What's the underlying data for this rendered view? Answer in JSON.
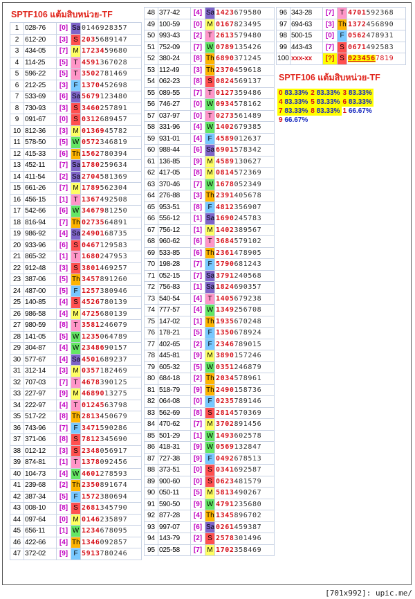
{
  "title": "SPTF106 แต้มสิบหน่วย-TF",
  "footer": "[701x992]: upic.me/",
  "colors": {
    "Sa": "#7e64c8",
    "T": "#ff96c8",
    "M": "#ffff64",
    "W": "#64e664",
    "F": "#78c8ff",
    "S": "#ff5050",
    "Th": "#ffb400"
  },
  "rows": [
    [
      "1",
      "028-76",
      "0",
      "Sa",
      "0146928357",
      "0"
    ],
    [
      "2",
      "612-20",
      "3",
      "S",
      "2035689147",
      "3"
    ],
    [
      "3",
      "434-05",
      "7",
      "M",
      "1723459680",
      "5"
    ],
    [
      "4",
      "114-25",
      "5",
      "T",
      "4591367028",
      "4"
    ],
    [
      "5",
      "596-22",
      "5",
      "T",
      "3502781469",
      "4"
    ],
    [
      "6",
      "212-25",
      "3",
      "F",
      "1370452698",
      "4"
    ],
    [
      "7",
      "533-69",
      "6",
      "Sa",
      "5679123480",
      "4"
    ],
    [
      "8",
      "730-93",
      "3",
      "S",
      "3460257891",
      "4"
    ],
    [
      "9",
      "091-67",
      "0",
      "S",
      "0312689457",
      "4"
    ],
    [
      "10",
      "812-36",
      "3",
      "M",
      "0136945782",
      "5"
    ],
    [
      "11",
      "578-50",
      "5",
      "W",
      "0572346819",
      "4"
    ],
    [
      "12",
      "415-33",
      "6",
      "Th",
      "1562780394",
      "4"
    ],
    [
      "13",
      "452-11",
      "7",
      "Sa",
      "1780259634",
      "4"
    ],
    [
      "14",
      "411-54",
      "2",
      "Sa",
      "2704581369",
      "4"
    ],
    [
      "15",
      "661-26",
      "7",
      "M",
      "1789562304",
      "4"
    ],
    [
      "16",
      "456-15",
      "1",
      "T",
      "1367492508",
      "4"
    ],
    [
      "17",
      "542-66",
      "6",
      "W",
      "3467981250",
      "5"
    ],
    [
      "18",
      "816-94",
      "7",
      "Th",
      "0273564891",
      "5"
    ],
    [
      "19",
      "986-92",
      "4",
      "Sa",
      "2490168735",
      "5"
    ],
    [
      "20",
      "933-96",
      "6",
      "S",
      "0467129583",
      "4"
    ],
    [
      "21",
      "865-32",
      "1",
      "T",
      "1680247953",
      "4"
    ],
    [
      "22",
      "912-48",
      "3",
      "S",
      "3801469257",
      "4"
    ],
    [
      "23",
      "387-06",
      "5",
      "Th",
      "3457891260",
      "4"
    ],
    [
      "24",
      "487-00",
      "5",
      "F",
      "1257380946",
      "4"
    ],
    [
      "25",
      "140-85",
      "4",
      "S",
      "4526780139",
      "4"
    ],
    [
      "26",
      "986-58",
      "4",
      "M",
      "4725680139",
      "4"
    ],
    [
      "27",
      "980-59",
      "8",
      "T",
      "3581246079",
      "4"
    ],
    [
      "28",
      "141-05",
      "5",
      "W",
      "1235064789",
      "4"
    ],
    [
      "29",
      "304-87",
      "4",
      "W",
      "2348690157",
      "5"
    ],
    [
      "30",
      "577-67",
      "4",
      "Sa",
      "4501689237",
      "4"
    ],
    [
      "31",
      "312-14",
      "3",
      "M",
      "0357182469",
      "4"
    ],
    [
      "32",
      "707-03",
      "7",
      "T",
      "4678390125",
      "4"
    ],
    [
      "33",
      "227-97",
      "9",
      "M",
      "4689013275",
      "5"
    ],
    [
      "34",
      "222-97",
      "4",
      "T",
      "0124563798",
      "5"
    ],
    [
      "35",
      "517-22",
      "8",
      "Th",
      "2813450679",
      "4"
    ],
    [
      "36",
      "743-96",
      "7",
      "F",
      "3471590286",
      "4"
    ],
    [
      "37",
      "371-06",
      "8",
      "S",
      "7812345690",
      "4"
    ],
    [
      "38",
      "012-12",
      "3",
      "S",
      "2348056917",
      "4"
    ],
    [
      "39",
      "874-81",
      "1",
      "T",
      "1378092456",
      "4"
    ],
    [
      "40",
      "104-73",
      "4",
      "W",
      "4601278593",
      "4"
    ],
    [
      "41",
      "239-68",
      "2",
      "Th",
      "2350891674",
      "4"
    ],
    [
      "42",
      "387-34",
      "5",
      "F",
      "1572380694",
      "4"
    ],
    [
      "43",
      "008-10",
      "8",
      "S",
      "2681345790",
      "4"
    ],
    [
      "44",
      "097-64",
      "0",
      "M",
      "0146235897",
      "4"
    ],
    [
      "45",
      "656-11",
      "1",
      "W",
      "1234678095",
      "4"
    ],
    [
      "46",
      "422-66",
      "4",
      "Th",
      "1346092857",
      "4"
    ],
    [
      "47",
      "372-02",
      "9",
      "F",
      "5913780246",
      "4"
    ],
    [
      "48",
      "377-42",
      "4",
      "Sa",
      "1423679580",
      "4"
    ],
    [
      "49",
      "100-59",
      "0",
      "M",
      "0167823495",
      "4"
    ],
    [
      "50",
      "993-43",
      "2",
      "T",
      "2613579480",
      "4"
    ],
    [
      "51",
      "752-09",
      "7",
      "W",
      "0789135426",
      "4"
    ],
    [
      "52",
      "380-24",
      "8",
      "Th",
      "6890371245",
      "4"
    ],
    [
      "53",
      "112-49",
      "3",
      "Th",
      "2370459618",
      "4"
    ],
    [
      "54",
      "062-23",
      "8",
      "S",
      "0824569137",
      "4"
    ],
    [
      "55",
      "089-55",
      "7",
      "T",
      "0127359486",
      "4"
    ],
    [
      "56",
      "746-27",
      "0",
      "W",
      "0934578162",
      "4"
    ],
    [
      "57",
      "037-97",
      "0",
      "T",
      "0273561489",
      "4"
    ],
    [
      "58",
      "331-96",
      "4",
      "W",
      "1402679385",
      "4"
    ],
    [
      "59",
      "931-01",
      "4",
      "F",
      "4589012637",
      "4"
    ],
    [
      "60",
      "988-44",
      "6",
      "Sa",
      "6901578342",
      "4"
    ],
    [
      "61",
      "136-85",
      "9",
      "M",
      "4589130627",
      "4"
    ],
    [
      "62",
      "417-05",
      "8",
      "M",
      "0814572369",
      "4"
    ],
    [
      "63",
      "370-46",
      "7",
      "W",
      "1678052349",
      "4"
    ],
    [
      "64",
      "276-88",
      "3",
      "Th",
      "2391405678",
      "4"
    ],
    [
      "65",
      "953-51",
      "8",
      "F",
      "4812356907",
      "4"
    ],
    [
      "66",
      "556-12",
      "1",
      "Sa",
      "1690245783",
      "4"
    ],
    [
      "67",
      "756-12",
      "1",
      "M",
      "1402389567",
      "4"
    ],
    [
      "68",
      "960-62",
      "6",
      "T",
      "3684579102",
      "4"
    ],
    [
      "69",
      "533-85",
      "6",
      "Th",
      "2361478905",
      "4"
    ],
    [
      "70",
      "198-28",
      "7",
      "F",
      "5790681243",
      "4"
    ],
    [
      "71",
      "052-15",
      "7",
      "Sa",
      "3791240568",
      "4"
    ],
    [
      "72",
      "756-83",
      "1",
      "Sa",
      "1824690357",
      "4"
    ],
    [
      "73",
      "540-54",
      "4",
      "T",
      "1405679238",
      "4"
    ],
    [
      "74",
      "777-57",
      "4",
      "W",
      "1349256708",
      "4"
    ],
    [
      "75",
      "147-02",
      "1",
      "Th",
      "1935670248",
      "4"
    ],
    [
      "76",
      "178-21",
      "5",
      "F",
      "1350678924",
      "4"
    ],
    [
      "77",
      "402-65",
      "2",
      "F",
      "2346789015",
      "4"
    ],
    [
      "78",
      "445-81",
      "9",
      "M",
      "3890157246",
      "4"
    ],
    [
      "79",
      "605-32",
      "5",
      "W",
      "0351246879",
      "4"
    ],
    [
      "80",
      "684-18",
      "2",
      "Th",
      "2034578961",
      "4"
    ],
    [
      "81",
      "518-79",
      "9",
      "Th",
      "2490158736",
      "4"
    ],
    [
      "82",
      "064-08",
      "0",
      "F",
      "0235789146",
      "4"
    ],
    [
      "83",
      "562-69",
      "8",
      "S",
      "2814570369",
      "4"
    ],
    [
      "84",
      "470-62",
      "7",
      "M",
      "3702891456",
      "4"
    ],
    [
      "85",
      "501-29",
      "1",
      "W",
      "1493602578",
      "4"
    ],
    [
      "86",
      "418-31",
      "9",
      "W",
      "0569132847",
      "4"
    ],
    [
      "87",
      "727-38",
      "9",
      "F",
      "0492678513",
      "4"
    ],
    [
      "88",
      "373-51",
      "0",
      "S",
      "0341692587",
      "4"
    ],
    [
      "89",
      "900-60",
      "0",
      "S",
      "0623481579",
      "4"
    ],
    [
      "90",
      "050-11",
      "5",
      "M",
      "5813490267",
      "4"
    ],
    [
      "91",
      "590-50",
      "9",
      "W",
      "4791235680",
      "4"
    ],
    [
      "92",
      "877-28",
      "4",
      "Th",
      "1345896702",
      "4"
    ],
    [
      "93",
      "997-07",
      "6",
      "Sa",
      "0261459387",
      "4"
    ],
    [
      "94",
      "143-79",
      "2",
      "S",
      "2578301496",
      "4"
    ],
    [
      "95",
      "025-58",
      "7",
      "M",
      "1702358469",
      "4"
    ],
    [
      "96",
      "343-28",
      "7",
      "T",
      "4701592368",
      "4"
    ],
    [
      "97",
      "694-63",
      "3",
      "Th",
      "1372456890",
      "4"
    ],
    [
      "98",
      "500-15",
      "0",
      "F",
      "0562478931",
      "4"
    ],
    [
      "99",
      "443-43",
      "7",
      "S",
      "0671492583",
      "4"
    ],
    [
      "100",
      "xxx-xx",
      "?",
      "S",
      "0234567819",
      "6"
    ]
  ],
  "stats_title": "SPTF106 แต้มสิบหน่วย-TF",
  "stats": [
    [
      {
        "n": "0",
        "v": "83.33%",
        "hl": true
      },
      {
        "n": "2",
        "v": "83.33%",
        "hl": true
      },
      {
        "n": "3",
        "v": "83.33%",
        "hl": true
      }
    ],
    [
      {
        "n": "4",
        "v": "83.33%",
        "hl": true
      },
      {
        "n": "5",
        "v": "83.33%",
        "hl": true
      },
      {
        "n": "6",
        "v": "83.33%",
        "hl": true
      }
    ],
    [
      {
        "n": "7",
        "v": "83.33%",
        "hl": true
      },
      {
        "n": "8",
        "v": "83.33%",
        "hl": true
      },
      {
        "n": "1",
        "v": "66.67%",
        "hl": false
      }
    ],
    [
      {
        "n": "9",
        "v": "66.67%",
        "hl": false
      }
    ]
  ]
}
